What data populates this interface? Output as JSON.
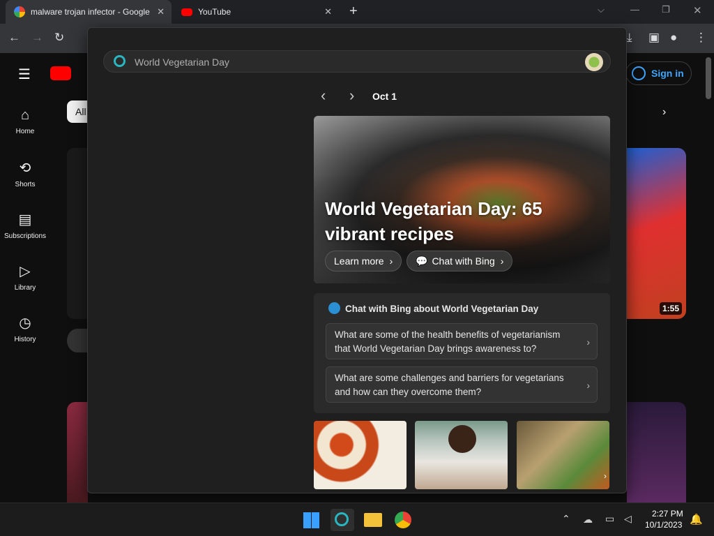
{
  "browser": {
    "tabs": [
      {
        "title": "malware trojan infector - Google"
      },
      {
        "title": "YouTube"
      }
    ],
    "new_tab": "+"
  },
  "youtube": {
    "sign_in": "Sign in",
    "chip_all": "All",
    "nav": [
      {
        "label": "Home"
      },
      {
        "label": "Shorts"
      },
      {
        "label": "Subscriptions"
      },
      {
        "label": "Library"
      },
      {
        "label": "History"
      }
    ],
    "video_duration": "1:55"
  },
  "bing_panel": {
    "search_placeholder": "World Vegetarian Day",
    "date": "Oct 1",
    "hero_title": "World Vegetarian Day: 65 vibrant recipes",
    "learn_more": "Learn more",
    "chat_with_bing": "Chat with Bing",
    "chat_heading": "Chat with Bing about World Vegetarian Day",
    "suggestions": [
      {
        "text": "What are some of the health benefits of vegetarianism that World Vegetarian Day brings awareness to?"
      },
      {
        "text": "What are some challenges and barriers for vegetarians and how can they overcome them?"
      }
    ]
  },
  "taskbar": {
    "time": "2:27 PM",
    "date": "10/1/2023"
  }
}
